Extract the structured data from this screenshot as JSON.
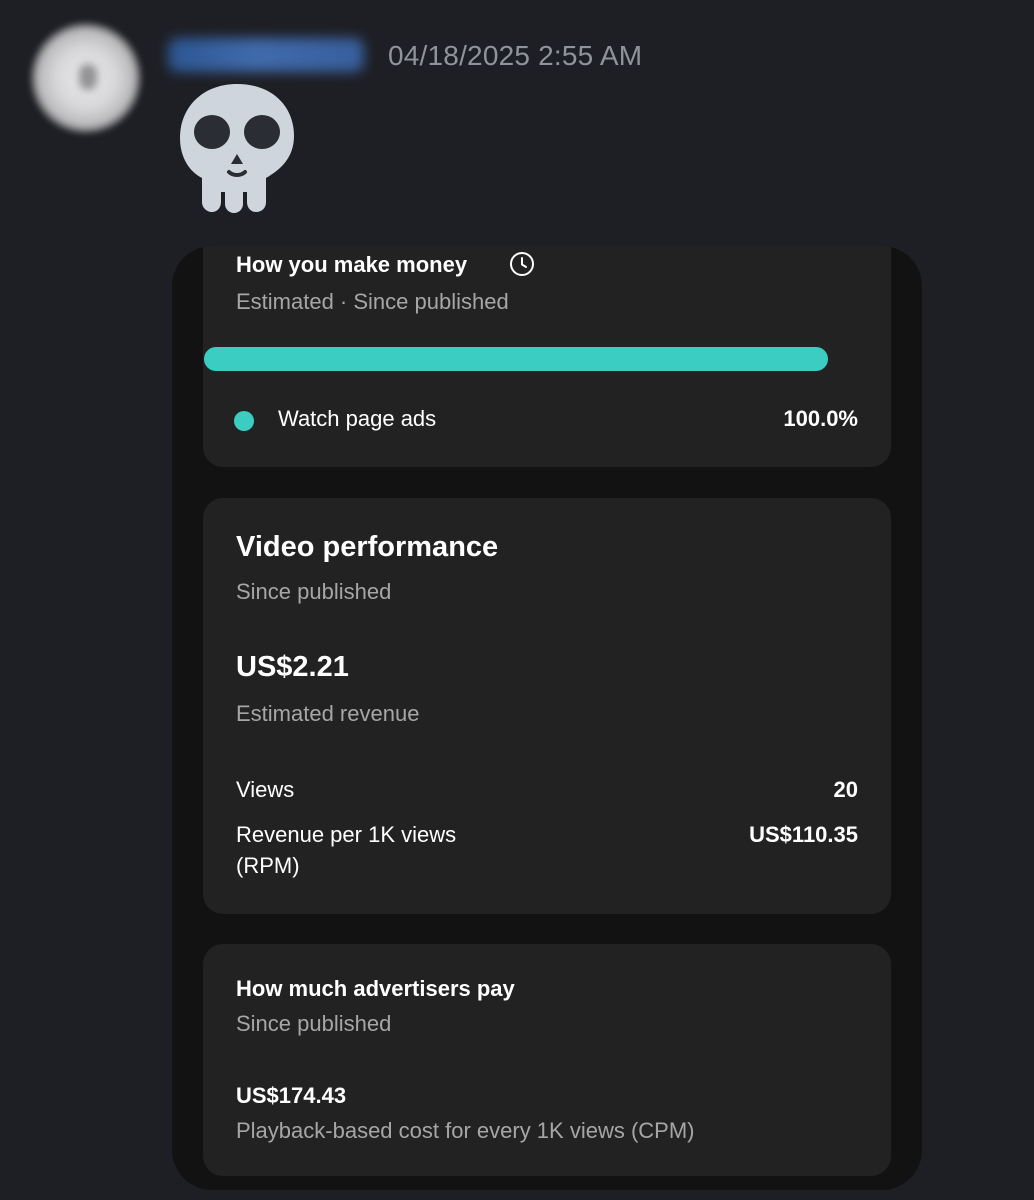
{
  "message": {
    "timestamp": "04/18/2025 2:55 AM",
    "emoji": "skull-emoji"
  },
  "money_card": {
    "title": "How you make money",
    "title_icon": "clock-icon",
    "subtitle": "Estimated · Since published",
    "bar": {
      "fill_fraction": 1.0,
      "color": "#3ccdc2"
    },
    "legend": [
      {
        "label": "Watch page ads",
        "value": "100.0%",
        "color": "#3ccdc2"
      }
    ]
  },
  "performance_card": {
    "title": "Video performance",
    "subtitle": "Since published",
    "revenue_amount": "US$2.21",
    "revenue_label": "Estimated revenue",
    "rows": [
      {
        "label": "Views",
        "value": "20"
      },
      {
        "label": "Revenue per 1K views (RPM)",
        "value": "US$110.35"
      }
    ]
  },
  "advertisers_card": {
    "title": "How much advertisers pay",
    "subtitle": "Since published",
    "amount": "US$174.43",
    "description": "Playback-based cost for every 1K views (CPM)"
  },
  "colors": {
    "background": "#1e1f24",
    "card": "#222222",
    "phone_background": "#121212",
    "accent_teal": "#3ccdc2",
    "timestamp_gray": "#8f939c",
    "muted_text": "#a6a6a6"
  }
}
